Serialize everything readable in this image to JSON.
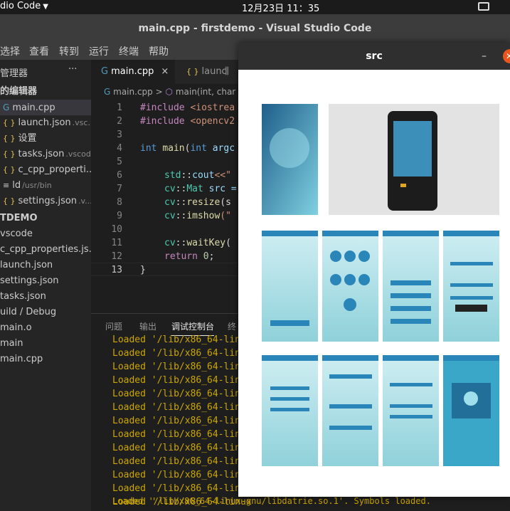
{
  "topbar": {
    "app_name": "dio Code",
    "clock": "12月23日  11：35"
  },
  "window": {
    "title": "main.cpp - firstdemo - Visual Studio Code"
  },
  "menu": [
    "选择",
    "查看",
    "转到",
    "运行",
    "终端",
    "帮助"
  ],
  "explorer": {
    "title": "管理器",
    "more": "···",
    "open_editors_label": "的编辑器",
    "open_editors": [
      {
        "name": "main.cpp",
        "sub": "",
        "icon": "cpp"
      },
      {
        "name": "launch.json",
        "sub": ".vsc...",
        "icon": "json"
      },
      {
        "name": "设置",
        "sub": "",
        "icon": "json"
      },
      {
        "name": "tasks.json",
        "sub": ".vscode",
        "icon": "json"
      },
      {
        "name": "c_cpp_properti...",
        "sub": "",
        "icon": "json"
      },
      {
        "name": "ld",
        "sub": "/usr/bin",
        "icon": "file"
      },
      {
        "name": "settings.json",
        "sub": ".v...",
        "icon": "json"
      }
    ],
    "folder_label": "TDEMO",
    "files": [
      "vscode",
      "c_cpp_properties.js...",
      "launch.json",
      "settings.json",
      "tasks.json",
      "uild / Debug",
      "main.o",
      "main",
      "main.cpp"
    ]
  },
  "tabs": [
    {
      "label": "main.cpp",
      "close": "×"
    },
    {
      "label": "launc"
    }
  ],
  "tabs_split": "⫼",
  "breadcrumb": {
    "file": "main.cpp",
    "sep": ">",
    "symbol": "main(int, char"
  },
  "code": {
    "line_numbers": [
      "1",
      "2",
      "3",
      "4",
      "5",
      "6",
      "7",
      "8",
      "9",
      "10",
      "11",
      "12",
      "13"
    ],
    "l1_kw": "#include",
    "l1_rest": " <iostrea",
    "l2_kw": "#include",
    "l2_rest": " <opencv2",
    "l4_type": "int",
    "l4_fn": "main",
    "l4_paren": "(",
    "l4_type2": "int",
    "l4_rest": " argc",
    "l6_ns": "std",
    "l6_op": "::",
    "l6_fn": "cout",
    "l6_rest": "<<\"",
    "l7_ns": "cv",
    "l7_op": "::",
    "l7_ty": "Mat",
    "l7_rest": " src =",
    "l8_ns": "cv",
    "l8_op": "::",
    "l8_fn": "resize",
    "l8_rest": "(s",
    "l9_ns": "cv",
    "l9_op": "::",
    "l9_fn": "imshow",
    "l9_rest": "(\"",
    "l11_ns": "cv",
    "l11_op": "::",
    "l11_fn": "waitKey",
    "l11_rest": "(",
    "l12_kw": "return",
    "l12_num": "0",
    "l12_rest": ";",
    "l13": "}"
  },
  "panel": {
    "tabs": [
      "问题",
      "输出",
      "调试控制台",
      "终"
    ],
    "log_lines": [
      "Loaded '/lib/x86_64-linux",
      "Loaded '/lib/x86_64-linux",
      "Loaded '/lib/x86_64-linux",
      "Loaded '/lib/x86_64-linux",
      "Loaded '/lib/x86_64-linux",
      "Loaded '/lib/x86_64-linux",
      "Loaded '/lib/x86_64-linux",
      "Loaded '/lib/x86_64-linux",
      "Loaded '/lib/x86_64-linux",
      "Loaded '/lib/x86_64-linux",
      "Loaded '/lib/x86_64-linux",
      "Loaded '/lib/x86_64-linux",
      "Loaded '/lib/x86_64-linux",
      "Loaded '/lib/x86_64-linux-gnu/libdatrie.so.1'. Symbols loaded."
    ]
  },
  "cv_window": {
    "title": "src",
    "minimize": "–",
    "close": "✕"
  },
  "colors": {
    "accent": "#2a86b8",
    "log": "#cca700",
    "close": "#e9541f"
  }
}
